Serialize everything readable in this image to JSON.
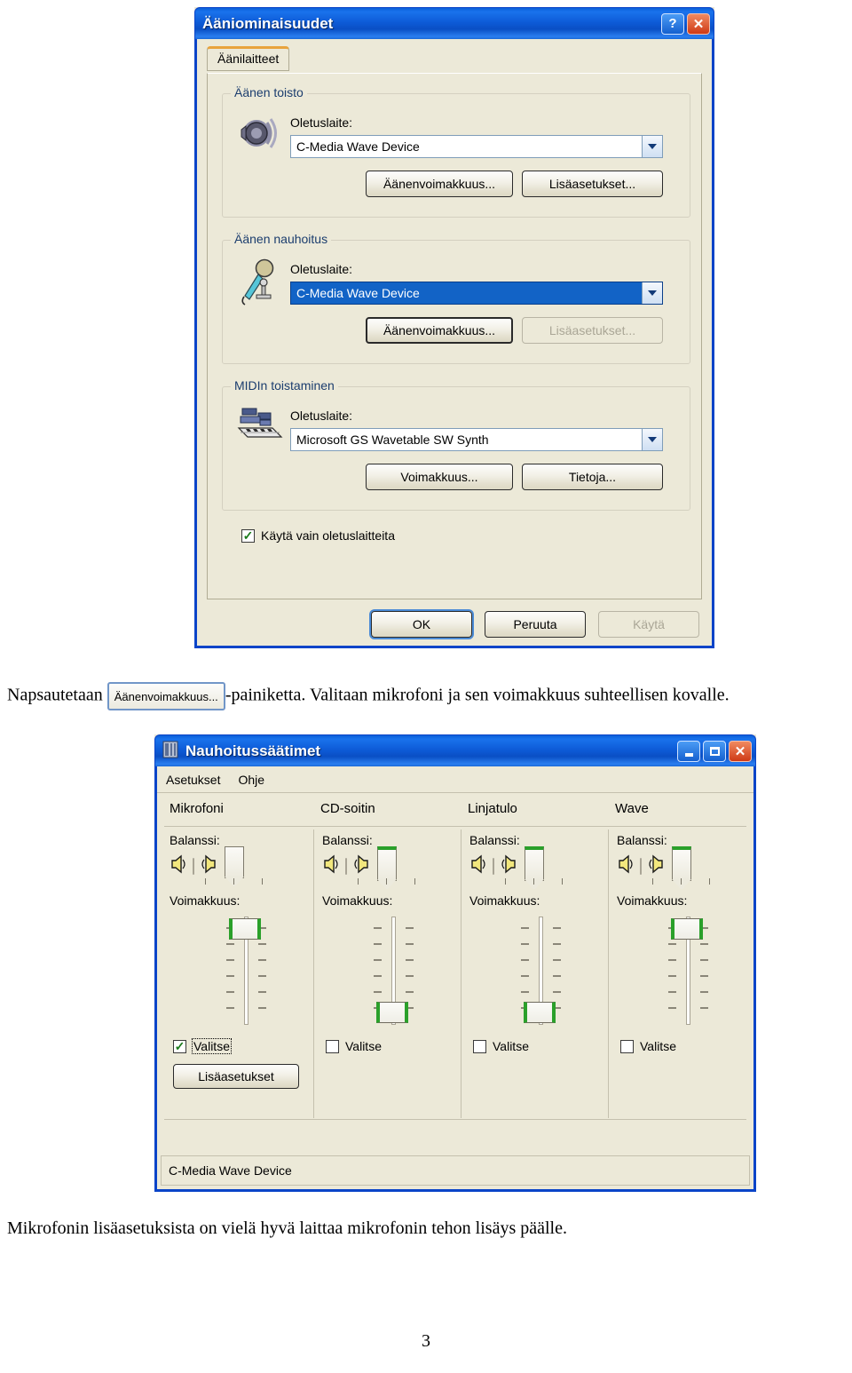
{
  "sound_properties_dialog": {
    "title": "Ääniominaisuudet",
    "titlebar_buttons": {
      "help": "?",
      "close": "✕"
    },
    "tab": {
      "label": "Äänilaitteet"
    },
    "playback_group": {
      "legend": "Äänen toisto",
      "icon": "speaker-icon",
      "device_label": "Oletuslaite:",
      "device_value": "C-Media Wave Device",
      "volume_button": "Äänenvoimakkuus...",
      "advanced_button": "Lisäasetukset..."
    },
    "recording_group": {
      "legend": "Äänen nauhoitus",
      "icon": "microphone-icon",
      "device_label": "Oletuslaite:",
      "device_value": "C-Media Wave Device",
      "volume_button": "Äänenvoimakkuus...",
      "advanced_button": "Lisäasetukset...",
      "advanced_disabled": true,
      "device_selected": true
    },
    "midi_group": {
      "legend": "MIDIn toistaminen",
      "icon": "midi-keyboard-icon",
      "device_label": "Oletuslaite:",
      "device_value": "Microsoft GS Wavetable SW Synth",
      "volume_button": "Voimakkuus...",
      "about_button": "Tietoja..."
    },
    "default_devices_checkbox": {
      "label": "Käytä vain oletuslaitteita",
      "checked": true
    },
    "buttons": {
      "ok": "OK",
      "cancel": "Peruuta",
      "apply": "Käytä",
      "apply_disabled": true
    }
  },
  "paragraph_one": {
    "before": "Napsautetaan",
    "inline_button": "Äänenvoimakkuus...",
    "after": "-painiketta. Valitaan mikrofoni ja sen voimakkuus suhteellisen kovalle."
  },
  "recording_mixer_window": {
    "title": "Nauhoitussäätimet",
    "icon": "mixer-icon",
    "titlebar_buttons": {
      "minimize": "_",
      "maximize": "□",
      "close": "✕"
    },
    "menu": [
      "Asetukset",
      "Ohje"
    ],
    "balance_label": "Balanssi:",
    "volume_label": "Voimakkuus:",
    "select_label": "Valitse",
    "advanced_button": "Lisäasetukset",
    "status": "C-Media Wave Device",
    "channels": [
      {
        "name": "Mikrofoni",
        "balance": 50,
        "volume": 88,
        "selected": true,
        "focused": true,
        "thumb_green": false
      },
      {
        "name": "CD-soitin",
        "balance": 50,
        "volume": 10,
        "selected": false,
        "focused": false,
        "thumb_green": true
      },
      {
        "name": "Linjatulo",
        "balance": 50,
        "volume": 10,
        "selected": false,
        "focused": false,
        "thumb_green": true
      },
      {
        "name": "Wave",
        "balance": 50,
        "volume": 88,
        "selected": false,
        "focused": false,
        "thumb_green": true
      }
    ]
  },
  "paragraph_two": {
    "text": "Mikrofonin lisäasetuksista on vielä hyvä laittaa mikrofonin tehon lisäys päälle."
  },
  "page_number": "3",
  "colors": {
    "titlebar_blue": "#0a4fc4",
    "window_face": "#ece9d8",
    "selection_blue": "#1263c6",
    "tab_accent": "#e8a33d",
    "close_red": "#cf3a16",
    "slider_green": "#2aa02a"
  }
}
